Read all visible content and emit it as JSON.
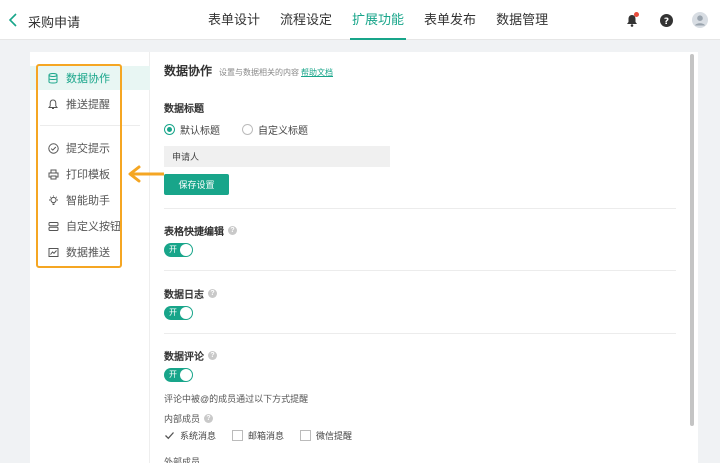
{
  "header": {
    "title": "采购申请",
    "tabs": [
      {
        "label": "表单设计"
      },
      {
        "label": "流程设定"
      },
      {
        "label": "扩展功能",
        "active": true
      },
      {
        "label": "表单发布"
      },
      {
        "label": "数据管理"
      }
    ]
  },
  "sidebar": {
    "items": [
      {
        "label": "数据协作",
        "icon": "database-icon",
        "active": true
      },
      {
        "label": "推送提醒",
        "icon": "bell-icon"
      },
      {
        "label": "提交提示",
        "icon": "check-circle-icon"
      },
      {
        "label": "打印模板",
        "icon": "printer-icon"
      },
      {
        "label": "智能助手",
        "icon": "lightbulb-icon"
      },
      {
        "label": "自定义按钮",
        "icon": "custom-button-icon"
      },
      {
        "label": "数据推送",
        "icon": "chart-icon"
      }
    ]
  },
  "content": {
    "title": "数据协作",
    "description": "设置与数据相关的内容",
    "help_link": "帮助文档",
    "data_title": {
      "label": "数据标题",
      "options": [
        {
          "label": "默认标题",
          "checked": true
        },
        {
          "label": "自定义标题",
          "checked": false
        }
      ],
      "input_value": "申请人",
      "save_label": "保存设置"
    },
    "quick_edit": {
      "label": "表格快捷编辑",
      "toggle": "开"
    },
    "data_log": {
      "label": "数据日志",
      "toggle": "开"
    },
    "data_comment": {
      "label": "数据评论",
      "toggle": "开",
      "notify_text": "评论中被@的成员通过以下方式提醒",
      "internal_label": "内部成员",
      "options": [
        {
          "label": "系统消息",
          "checked": true
        },
        {
          "label": "邮箱消息",
          "checked": false
        },
        {
          "label": "微信提醒",
          "checked": false
        }
      ],
      "external_label": "外部成员"
    }
  },
  "colors": {
    "accent": "#18a58a",
    "highlight": "#f5a623"
  }
}
